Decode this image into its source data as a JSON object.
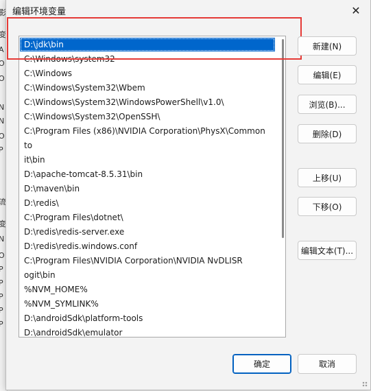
{
  "dialog": {
    "title": "编辑环境变量",
    "close_glyph": "✕"
  },
  "path_list": [
    "D:\\jdk\\bin",
    "C:\\Windows\\system32",
    "C:\\Windows",
    "C:\\Windows\\System32\\Wbem",
    "C:\\Windows\\System32\\WindowsPowerShell\\v1.0\\",
    "C:\\Windows\\System32\\OpenSSH\\",
    "C:\\Program Files (x86)\\NVIDIA Corporation\\PhysX\\Common",
    "to",
    "it\\bin",
    "D:\\apache-tomcat-8.5.31\\bin",
    "D:\\maven\\bin",
    "D:\\redis\\",
    "C:\\Program Files\\dotnet\\",
    "D:\\redis\\redis-server.exe",
    "D:\\redis\\redis.windows.conf",
    "C:\\Program Files\\NVIDIA Corporation\\NVIDIA NvDLISR",
    "ogit\\bin",
    "%NVM_HOME%",
    "%NVM_SYMLINK%",
    "D:\\androidSdk\\platform-tools",
    "D:\\androidSdk\\emulator"
  ],
  "buttons": {
    "new": "新建(N)",
    "edit": "编辑(E)",
    "browse": "浏览(B)...",
    "delete": "删除(D)",
    "move_up": "上移(U)",
    "move_down": "下移(O)",
    "edit_text": "编辑文本(T)...",
    "ok": "确定",
    "cancel": "取消"
  },
  "background_window_fragments": [
    "影",
    "变",
    "A",
    "O",
    "O",
    "N",
    "N",
    "O",
    "P",
    "流",
    "变",
    "N",
    "O",
    "P",
    "P",
    "P",
    "P",
    "P"
  ],
  "accent_color": "#0066cc",
  "annotation_color": "#e53935"
}
